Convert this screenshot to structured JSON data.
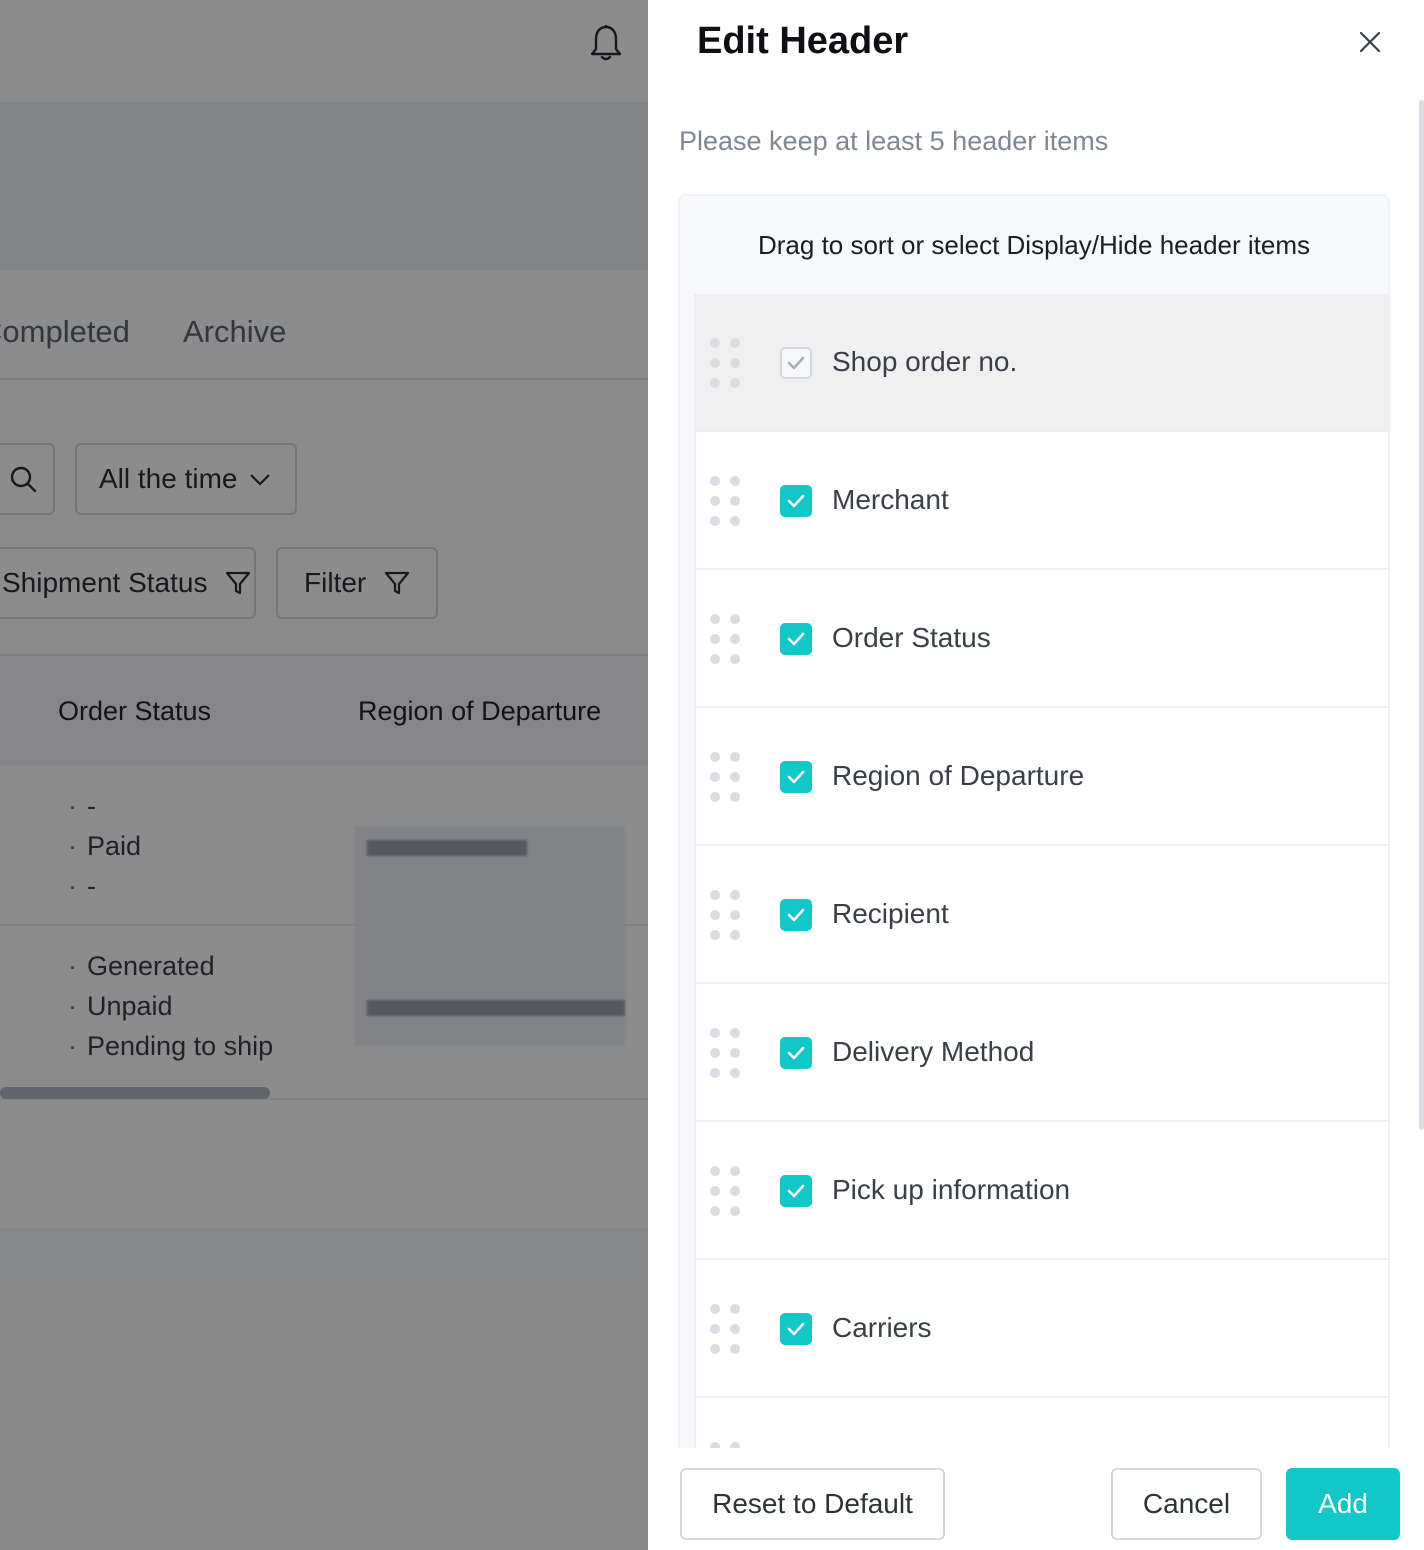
{
  "background_page": {
    "tabs": [
      "Completed",
      "Archive"
    ],
    "time_select": "All the time",
    "shipment_filter_label": "Shipment Status",
    "filter_label": "Filter",
    "table_headers": [
      "Order Status",
      "Region of Departure"
    ],
    "rows": [
      {
        "statuses": [
          "-",
          "Paid",
          "-"
        ]
      },
      {
        "statuses": [
          "Generated",
          "Unpaid",
          "Pending to ship"
        ]
      }
    ]
  },
  "drawer": {
    "title": "Edit Header",
    "hint": "Please keep at least 5 header items",
    "list_header": "Drag to sort or select Display/Hide header items",
    "items": [
      {
        "label": "Shop order no.",
        "checked": true,
        "locked": true
      },
      {
        "label": "Merchant",
        "checked": true,
        "locked": false
      },
      {
        "label": "Order Status",
        "checked": true,
        "locked": false
      },
      {
        "label": "Region of Departure",
        "checked": true,
        "locked": false
      },
      {
        "label": "Recipient",
        "checked": true,
        "locked": false
      },
      {
        "label": "Delivery Method",
        "checked": true,
        "locked": false
      },
      {
        "label": "Pick up information",
        "checked": true,
        "locked": false
      },
      {
        "label": "Carriers",
        "checked": true,
        "locked": false
      },
      {
        "label": "",
        "checked": false,
        "locked": false
      }
    ],
    "buttons": {
      "reset": "Reset to Default",
      "cancel": "Cancel",
      "add": "Add"
    }
  },
  "colors": {
    "accent": "#12c7c8",
    "overlay": "rgba(0,0,0,0.45)"
  },
  "icons": {
    "bell": "bell-icon",
    "close": "close-icon",
    "search": "search-icon",
    "chevron": "chevron-down-icon",
    "filter": "filter-icon",
    "drag": "drag-handle-icon",
    "check": "check-icon"
  }
}
